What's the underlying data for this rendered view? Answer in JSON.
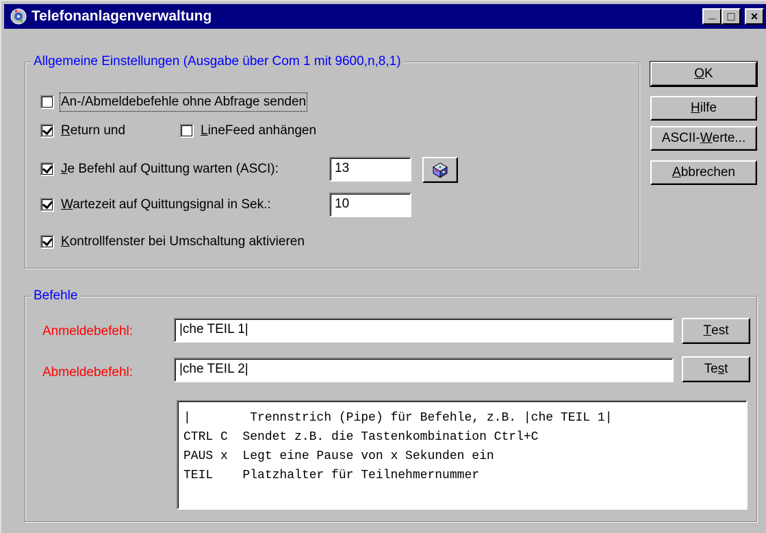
{
  "window": {
    "title": "Telefonanlagenverwaltung",
    "minimize_glyph": "_",
    "maximize_glyph": "□",
    "close_glyph": "×"
  },
  "general_settings": {
    "legend": "Allgemeine Einstellungen (Ausgabe über Com 1 mit 9600,n,8,1)",
    "send_without_prompt": {
      "label_prefix": "",
      "label": "An-/Abmeldebefehle ohne Abfrage senden",
      "checked": false
    },
    "return": {
      "mnemonic": "R",
      "label_rest": "eturn und",
      "checked": true
    },
    "linefeed": {
      "mnemonic": "L",
      "label_rest": "ineFeed anhängen",
      "checked": false
    },
    "wait_ack": {
      "mnemonic": "J",
      "label_rest": "e Befehl auf Quittung warten (ASCI):",
      "checked": true,
      "value": "13"
    },
    "wait_time": {
      "mnemonic": "W",
      "label_rest": "artezeit auf Quittungsignal in Sek.:",
      "checked": true,
      "value": "10"
    },
    "control_window": {
      "mnemonic": "K",
      "label_rest": "ontrollfenster bei Umschaltung aktivieren",
      "checked": true
    }
  },
  "side_buttons": {
    "ok": {
      "mnemonic": "O",
      "rest": "K"
    },
    "help": {
      "mnemonic": "H",
      "rest": "ilfe"
    },
    "ascii": {
      "before": "ASCII-",
      "mnemonic": "W",
      "rest": "erte..."
    },
    "cancel": {
      "mnemonic": "A",
      "rest": "bbrechen"
    }
  },
  "commands": {
    "legend": "Befehle",
    "login_label": "Anmeldebefehl:",
    "login_value": "|che TEIL 1|",
    "logout_label": "Abmeldebefehl:",
    "logout_value": "|che TEIL 2|",
    "test1": {
      "mnemonic": "T",
      "rest": "est"
    },
    "test2": {
      "before": "Te",
      "mnemonic": "s",
      "rest": "t"
    },
    "help_lines": [
      "|        Trennstrich (Pipe) für Befehle, z.B. |che TEIL 1|",
      "CTRL C  Sendet z.B. die Tastenkombination Ctrl+C",
      "PAUS x  Legt eine Pause von x Sekunden ein",
      "TEIL    Platzhalter für Teilnehmernummer"
    ]
  },
  "colors": {
    "titlebar": "#000080",
    "legend": "#0000ff",
    "command_label": "#ff0000",
    "face": "#c0c0c0"
  },
  "icons": {
    "title": "phone-system-icon",
    "wait_ack_button": "phone-dice-icon"
  }
}
